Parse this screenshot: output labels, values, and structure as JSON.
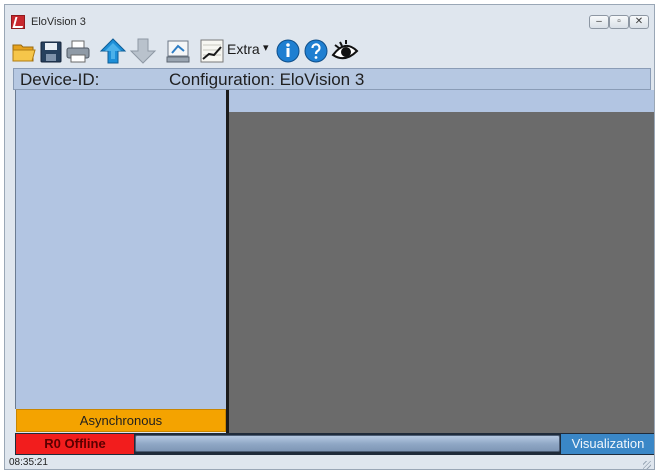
{
  "window": {
    "title": "EloVision 3",
    "minimize_glyph": "–",
    "restore_glyph": "▫",
    "close_glyph": "✕"
  },
  "toolbar": {
    "extra_label": "Extra",
    "extra_arrow": "▾",
    "icons": [
      "open-folder-icon",
      "save-icon",
      "print-icon",
      "upload-icon",
      "download-icon",
      "connect-icon",
      "chart-icon",
      "info-icon",
      "help-icon",
      "eye-icon"
    ]
  },
  "device_bar": {
    "device_id_label": "Device-ID:",
    "configuration_label": "Configuration: EloVision 3"
  },
  "left_panel": {
    "mode_label": "Asynchronous"
  },
  "status_bar": {
    "offline_label": "R0 Offline",
    "visualization_label": "Visualization",
    "time": "08:35:21"
  },
  "colors": {
    "offline": "#f21d1d",
    "async": "#f4a300",
    "visualization": "#3a87c7",
    "panel": "#b2c5e2",
    "workspace": "#6b6b6b"
  }
}
